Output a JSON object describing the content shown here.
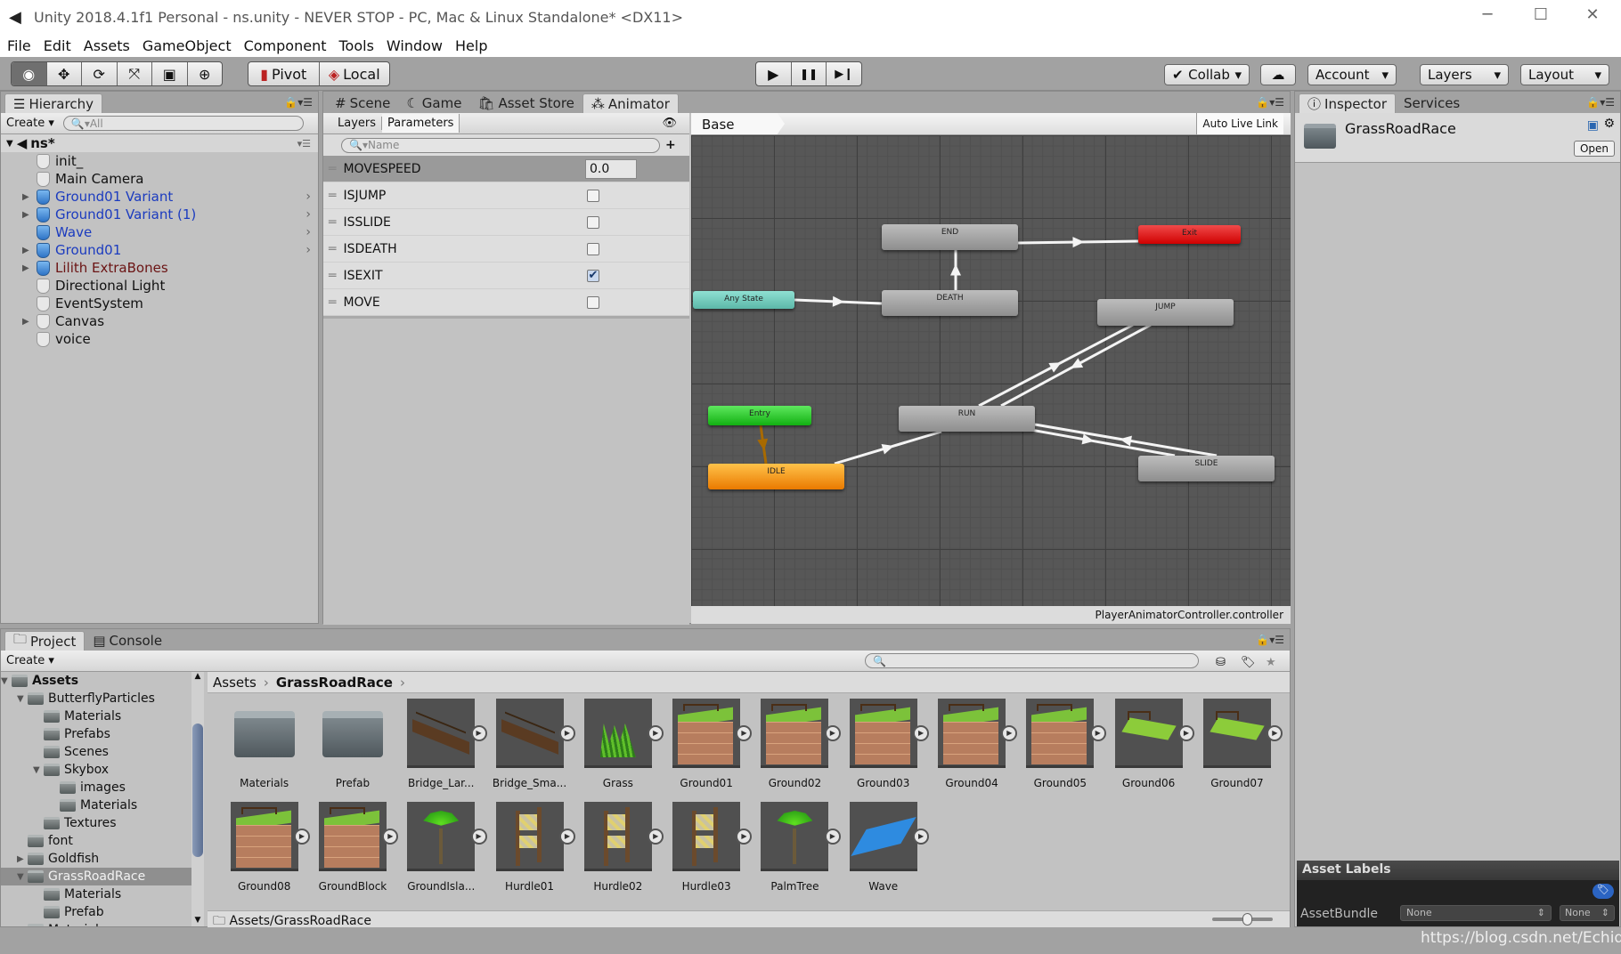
{
  "window": {
    "title": "Unity 2018.4.1f1 Personal - ns.unity - NEVER STOP - PC, Mac & Linux Standalone* <DX11>",
    "minimize": "─",
    "maximize": "☐",
    "close": "✕"
  },
  "menu": [
    "File",
    "Edit",
    "Assets",
    "GameObject",
    "Component",
    "Tools",
    "Window",
    "Help"
  ],
  "toolbar": {
    "tools": [
      "◉",
      "✥",
      "⟳",
      "⤧",
      "▣",
      "⊕"
    ],
    "pivot": "Pivot",
    "local": "Local",
    "play": "▶",
    "pause": "❚❚",
    "step": "▶❙",
    "collab": "Collab",
    "account": "Account",
    "layers": "Layers",
    "layout": "Layout",
    "dropdown_arrow": "▾"
  },
  "hierarchy": {
    "tab": "Hierarchy",
    "create": "Create",
    "search_placeholder": "All",
    "scene": "ns*",
    "items": [
      {
        "name": "init_",
        "type": "plain",
        "expand": false,
        "chev": false
      },
      {
        "name": "Main Camera",
        "type": "plain",
        "expand": false,
        "chev": false
      },
      {
        "name": "Ground01 Variant",
        "type": "prefab",
        "expand": true,
        "chev": true,
        "color": "#1b3bbf"
      },
      {
        "name": "Ground01 Variant (1)",
        "type": "prefab",
        "expand": true,
        "chev": true,
        "color": "#1b3bbf"
      },
      {
        "name": "Wave",
        "type": "prefab",
        "expand": false,
        "chev": true,
        "color": "#1b3bbf"
      },
      {
        "name": "Ground01",
        "type": "prefab",
        "expand": true,
        "chev": true,
        "color": "#1b3bbf"
      },
      {
        "name": "Lilith ExtraBones",
        "type": "prefab",
        "expand": true,
        "chev": false,
        "color": "#6b1414"
      },
      {
        "name": "Directional Light",
        "type": "plain",
        "expand": false,
        "chev": false
      },
      {
        "name": "EventSystem",
        "type": "plain",
        "expand": false,
        "chev": false
      },
      {
        "name": "Canvas",
        "type": "plain",
        "expand": true,
        "chev": false
      },
      {
        "name": "voice",
        "type": "plain",
        "expand": false,
        "chev": false
      }
    ]
  },
  "center_tabs": [
    "Scene",
    "Game",
    "Asset Store",
    "Animator"
  ],
  "animator": {
    "subtabs": [
      "Layers",
      "Parameters"
    ],
    "search_placeholder": "Name",
    "add": "+",
    "breadcrumb": "Base Layer",
    "auto_live_link": "Auto Live Link",
    "footer": "PlayerAnimatorController.controller",
    "parameters": [
      {
        "name": "MOVESPEED",
        "type": "float",
        "value": "0.0"
      },
      {
        "name": "ISJUMP",
        "type": "bool",
        "value": false
      },
      {
        "name": "ISSLIDE",
        "type": "bool",
        "value": false
      },
      {
        "name": "ISDEATH",
        "type": "bool",
        "value": false
      },
      {
        "name": "ISEXIT",
        "type": "bool",
        "value": true
      },
      {
        "name": "MOVE",
        "type": "bool",
        "value": false
      }
    ],
    "states": [
      {
        "id": "END",
        "label": "END",
        "kind": "state"
      },
      {
        "id": "Exit",
        "label": "Exit",
        "kind": "exit",
        "color": "#e01010"
      },
      {
        "id": "Any",
        "label": "Any State",
        "kind": "any",
        "color": "#72cfc0"
      },
      {
        "id": "DEATH",
        "label": "DEATH",
        "kind": "state"
      },
      {
        "id": "JUMP",
        "label": "JUMP",
        "kind": "state"
      },
      {
        "id": "Entry",
        "label": "Entry",
        "kind": "entry",
        "color": "#2ecc2e"
      },
      {
        "id": "RUN",
        "label": "RUN",
        "kind": "state"
      },
      {
        "id": "IDLE",
        "label": "IDLE",
        "kind": "default",
        "color": "#f59a1c"
      },
      {
        "id": "SLIDE",
        "label": "SLIDE",
        "kind": "state"
      }
    ],
    "transitions": [
      {
        "from": "Any",
        "to": "DEATH"
      },
      {
        "from": "DEATH",
        "to": "END"
      },
      {
        "from": "END",
        "to": "Exit"
      },
      {
        "from": "Entry",
        "to": "IDLE",
        "color": "#a86a00"
      },
      {
        "from": "IDLE",
        "to": "RUN"
      },
      {
        "from": "RUN",
        "to": "JUMP"
      },
      {
        "from": "JUMP",
        "to": "RUN"
      },
      {
        "from": "RUN",
        "to": "SLIDE"
      },
      {
        "from": "SLIDE",
        "to": "RUN"
      }
    ]
  },
  "inspector": {
    "tabs": [
      "Inspector",
      "Services"
    ],
    "object": "GrassRoadRace",
    "open": "Open",
    "asset_labels": "Asset Labels",
    "assetbundle_label": "AssetBundle",
    "bundle": "None",
    "variant": "None"
  },
  "project": {
    "tabs": [
      "Project",
      "Console"
    ],
    "create": "Create",
    "breadcrumb": [
      "Assets",
      "GrassRoadRace"
    ],
    "path": "Assets/GrassRoadRace",
    "tree": [
      {
        "name": "Assets",
        "depth": 0,
        "expand": "open",
        "bold": true
      },
      {
        "name": "ButterflyParticles",
        "depth": 1,
        "expand": "open"
      },
      {
        "name": "Materials",
        "depth": 2
      },
      {
        "name": "Prefabs",
        "depth": 2
      },
      {
        "name": "Scenes",
        "depth": 2
      },
      {
        "name": "Skybox",
        "depth": 2,
        "expand": "open"
      },
      {
        "name": "images",
        "depth": 3
      },
      {
        "name": "Materials",
        "depth": 3
      },
      {
        "name": "Textures",
        "depth": 2
      },
      {
        "name": "font",
        "depth": 1
      },
      {
        "name": "Goldfish",
        "depth": 1,
        "expand": "closed"
      },
      {
        "name": "GrassRoadRace",
        "depth": 1,
        "expand": "open",
        "selected": true
      },
      {
        "name": "Materials",
        "depth": 2
      },
      {
        "name": "Prefab",
        "depth": 2
      },
      {
        "name": "Materials",
        "depth": 1
      }
    ],
    "assets": [
      {
        "name": "Materials",
        "kind": "folder"
      },
      {
        "name": "Prefab",
        "kind": "folder"
      },
      {
        "name": "Bridge_Lar...",
        "kind": "bridge"
      },
      {
        "name": "Bridge_Sma...",
        "kind": "bridge"
      },
      {
        "name": "Grass",
        "kind": "grass"
      },
      {
        "name": "Ground01",
        "kind": "block"
      },
      {
        "name": "Ground02",
        "kind": "block"
      },
      {
        "name": "Ground03",
        "kind": "block"
      },
      {
        "name": "Ground04",
        "kind": "block"
      },
      {
        "name": "Ground05",
        "kind": "block"
      },
      {
        "name": "Ground06",
        "kind": "flat"
      },
      {
        "name": "Ground07",
        "kind": "flat"
      },
      {
        "name": "Ground08",
        "kind": "block"
      },
      {
        "name": "GroundBlock",
        "kind": "block"
      },
      {
        "name": "GroundIsla...",
        "kind": "palm"
      },
      {
        "name": "Hurdle01",
        "kind": "hurdle"
      },
      {
        "name": "Hurdle02",
        "kind": "hurdle"
      },
      {
        "name": "Hurdle03",
        "kind": "hurdle"
      },
      {
        "name": "PalmTree",
        "kind": "palm"
      },
      {
        "name": "Wave",
        "kind": "water"
      }
    ]
  },
  "watermark": "https://blog.csdn.net/Echidna_"
}
